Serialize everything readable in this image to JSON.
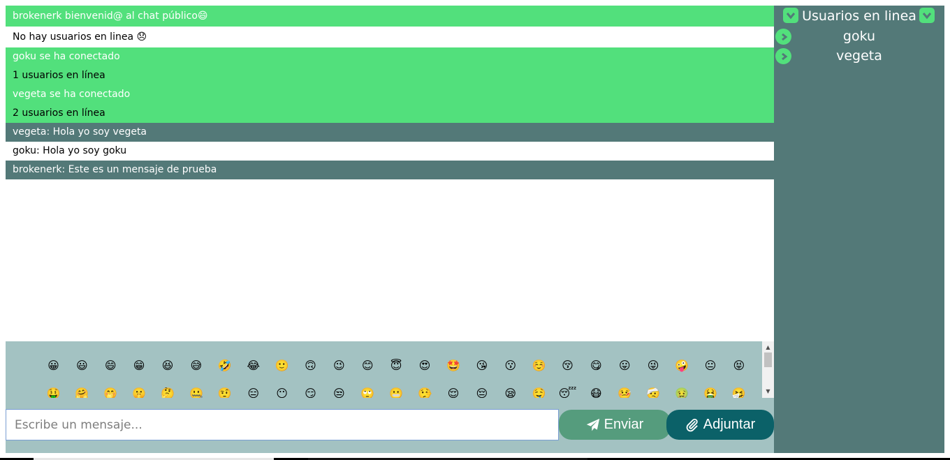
{
  "chat": {
    "messages": [
      {
        "text": "brokenerk bienvenid@ al chat público😄"
      },
      {
        "text": "No hay usuarios en linea 😞"
      },
      {
        "text": "goku se ha conectado"
      },
      {
        "text": "1 usuarios en línea"
      },
      {
        "text": "vegeta se ha conectado"
      },
      {
        "text": "2 usuarios en línea"
      },
      {
        "text": "vegeta: Hola yo soy vegeta"
      },
      {
        "text": "goku: Hola yo soy goku"
      },
      {
        "text": "brokenerk: Este es un mensaje de prueba"
      }
    ]
  },
  "emoji_tray": {
    "row1": [
      "😀",
      "😃",
      "😄",
      "😁",
      "😆",
      "😅",
      "🤣",
      "😂",
      "🙂",
      "🙃",
      "😉",
      "😊",
      "😇",
      "😍",
      "🤩",
      "😘",
      "😗",
      "☺️",
      "😚",
      "😋",
      "😛",
      "😜",
      "🤪",
      "😐",
      "😝"
    ],
    "row2": [
      "🤑",
      "🤗",
      "🤭",
      "🤫",
      "🤔",
      "🤐",
      "🤨",
      "😑",
      "😶",
      "😏",
      "😒",
      "🙄",
      "😬",
      "🤥",
      "😌",
      "😔",
      "😪",
      "🤤",
      "😴",
      "😷",
      "🤒",
      "🤕",
      "🤢",
      "🤮",
      "🤧"
    ]
  },
  "composer": {
    "placeholder": "Escribe un mensaje...",
    "send_label": "Enviar",
    "attach_label": "Adjuntar"
  },
  "sidebar": {
    "title": "Usuarios en linea",
    "users": [
      {
        "name": "goku"
      },
      {
        "name": "vegeta"
      }
    ]
  },
  "colors": {
    "green": "#52e07c",
    "teal": "#537978",
    "tray": "#a3c2c2",
    "send": "#559c7d",
    "attach": "#0b6168"
  }
}
